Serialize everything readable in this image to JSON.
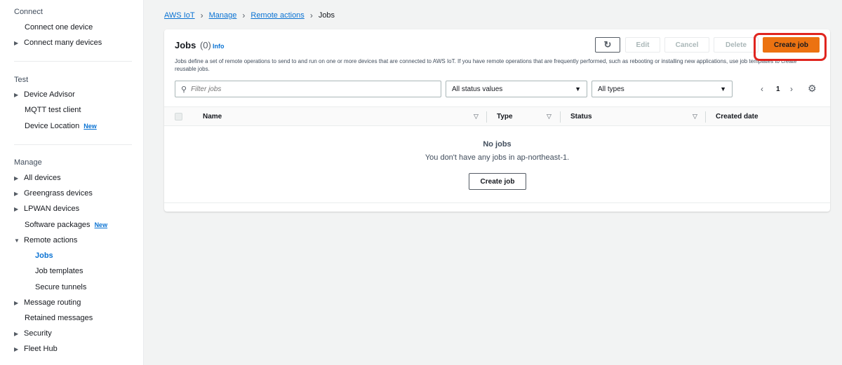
{
  "sidebar": {
    "connect": {
      "title": "Connect",
      "items": [
        {
          "label": "Connect one device"
        },
        {
          "label": "Connect many devices"
        }
      ]
    },
    "test": {
      "title": "Test",
      "items": [
        {
          "label": "Device Advisor"
        },
        {
          "label": "MQTT test client"
        },
        {
          "label": "Device Location",
          "badge": "New"
        }
      ]
    },
    "manage": {
      "title": "Manage",
      "items": [
        {
          "label": "All devices"
        },
        {
          "label": "Greengrass devices"
        },
        {
          "label": "LPWAN devices"
        },
        {
          "label": "Software packages",
          "badge": "New"
        },
        {
          "label": "Remote actions"
        },
        {
          "label": "Jobs"
        },
        {
          "label": "Job templates"
        },
        {
          "label": "Secure tunnels"
        },
        {
          "label": "Message routing"
        },
        {
          "label": "Retained messages"
        },
        {
          "label": "Security"
        },
        {
          "label": "Fleet Hub"
        }
      ]
    }
  },
  "breadcrumb": {
    "items": [
      "AWS IoT",
      "Manage",
      "Remote actions"
    ],
    "current": "Jobs"
  },
  "panel": {
    "title": "Jobs",
    "count": "(0)",
    "info": "Info",
    "description": "Jobs define a set of remote operations to send to and run on one or more devices that are connected to AWS IoT. If you have remote operations that are frequently performed, such as rebooting or installing new applications, use job templates to create reusable jobs.",
    "buttons": {
      "refresh": "↻",
      "edit": "Edit",
      "cancel": "Cancel",
      "delete": "Delete",
      "create": "Create job"
    },
    "filter_placeholder": "Filter jobs",
    "status_select": "All status values",
    "type_select": "All types",
    "pagination": {
      "page": "1"
    },
    "columns": [
      "Name",
      "Type",
      "Status",
      "Created date"
    ],
    "empty": {
      "title": "No jobs",
      "description": "You don't have any jobs in ap-northeast-1.",
      "button": "Create job"
    }
  },
  "colors": {
    "primary": "#ec7211",
    "link": "#0972d3",
    "highlight": "#e0251f"
  }
}
